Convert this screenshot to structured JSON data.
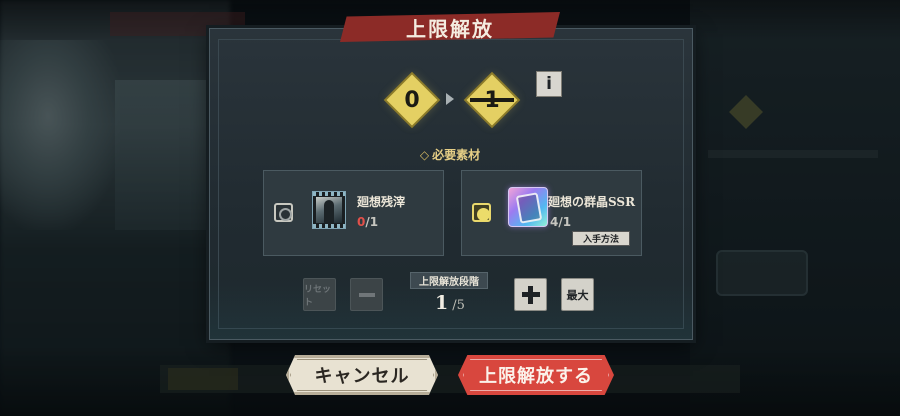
{
  "dialog": {
    "title": "上限解放",
    "level_from": "0",
    "level_to": "1",
    "info_label": "i",
    "materials_header": "必要素材",
    "materials_header_bullet": "◇",
    "materials": [
      {
        "name": "廻想残滓",
        "have": "0",
        "need": "1",
        "selected": false,
        "icon": "film-fragment-icon"
      },
      {
        "name": "廻想の群晶SSR",
        "have": "4",
        "need": "1",
        "selected": true,
        "icon": "ssr-crystal-icon",
        "acquire_label": "入手方法"
      }
    ],
    "stage": {
      "label": "上限解放段階",
      "current": "1",
      "max": "5",
      "reset_label": "リセット",
      "max_label": "最大"
    }
  },
  "buttons": {
    "cancel": "キャンセル",
    "confirm": "上限解放する"
  },
  "colors": {
    "accent_red": "#d8473e",
    "title_ribbon": "#8c2b27",
    "diamond_gold": "#e4d063",
    "shortage_red": "#e2504a",
    "panel": "#2a343b"
  }
}
